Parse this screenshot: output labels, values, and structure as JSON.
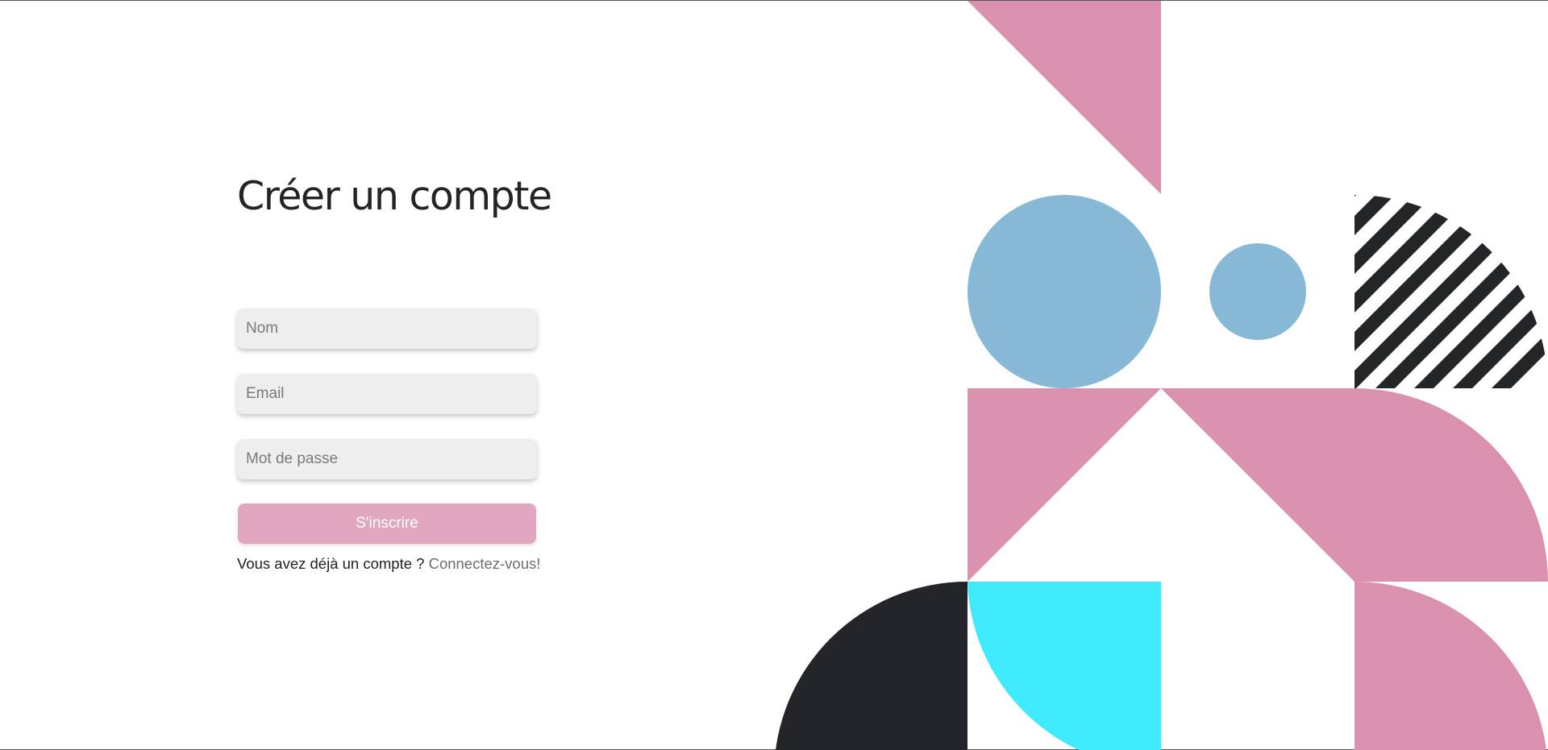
{
  "signup": {
    "title": "Créer un compte",
    "name_placeholder": "Nom",
    "email_placeholder": "Email",
    "password_placeholder": "Mot de passe",
    "submit_label": "S'inscrire",
    "login_prompt": "Vous avez déjà un compte ? ",
    "login_link": "Connectez-vous!"
  },
  "colors": {
    "pink": "#da91ae",
    "button_pink": "#e1a7bf",
    "light_blue": "#87b9d6",
    "cyan": "#3feafd",
    "dark": "#242529",
    "field_bg": "#eeeeee"
  }
}
